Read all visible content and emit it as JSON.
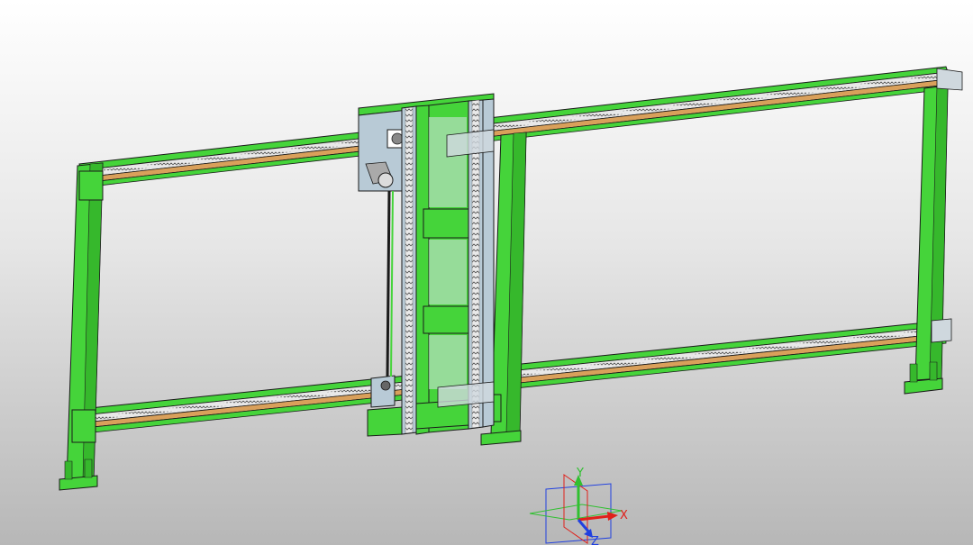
{
  "viewport": {
    "background_top": "#ffffff",
    "background_bottom": "#b7b7b7"
  },
  "model": {
    "frame_color": "#45d43a",
    "frame_dark": "#1f7a17",
    "rail_color": "#d9a05b",
    "carriage_color": "#b8cad6",
    "outline_color": "#1a1a1a"
  },
  "triad": {
    "x_label": "X",
    "y_label": "Y",
    "z_label": "Z",
    "x_color": "#e0201a",
    "y_color": "#30c030",
    "z_color": "#2040e0"
  }
}
